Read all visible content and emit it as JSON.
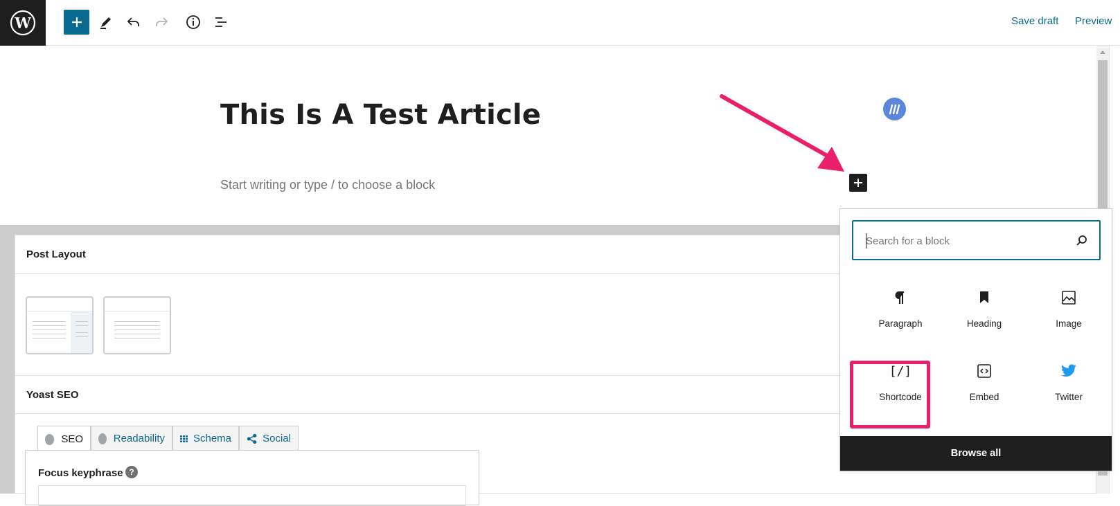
{
  "toolbar": {
    "logo_icon": "wordpress-logo-icon",
    "add_block_icon": "plus-icon",
    "tools": [
      "pencil-icon",
      "undo-icon",
      "redo-icon",
      "info-icon",
      "list-view-icon"
    ],
    "save_draft_label": "Save draft",
    "preview_label": "Preview"
  },
  "editor": {
    "title": "This Is A Test Article",
    "placeholder": "Start writing or type / to choose a block"
  },
  "post_layout": {
    "heading": "Post Layout",
    "options": [
      "sidebar-layout",
      "full-width-layout"
    ]
  },
  "yoast": {
    "heading": "Yoast SEO",
    "tabs": [
      {
        "label": "SEO",
        "icon": "gray-dot-icon",
        "active": true
      },
      {
        "label": "Readability",
        "icon": "gray-dot-icon",
        "active": false
      },
      {
        "label": "Schema",
        "icon": "grid-icon",
        "active": false
      },
      {
        "label": "Social",
        "icon": "share-icon",
        "active": false
      }
    ],
    "focus_label": "Focus keyphrase",
    "help_glyph": "?"
  },
  "inserter": {
    "search_placeholder": "Search for a block",
    "blocks": [
      {
        "label": "Paragraph",
        "icon": "paragraph-icon"
      },
      {
        "label": "Heading",
        "icon": "bookmark-icon"
      },
      {
        "label": "Image",
        "icon": "image-icon"
      },
      {
        "label": "Shortcode",
        "icon": "shortcode-icon",
        "glyph": "[/]"
      },
      {
        "label": "Embed",
        "icon": "embed-icon"
      },
      {
        "label": "Twitter",
        "icon": "twitter-icon"
      }
    ],
    "browse_all_label": "Browse all"
  },
  "colors": {
    "accent": "#0b6a8f",
    "annotation": "#ea1f6b",
    "dark": "#1e1e1e",
    "avatar": "#5a86dc",
    "twitter": "#1d9bf0"
  }
}
